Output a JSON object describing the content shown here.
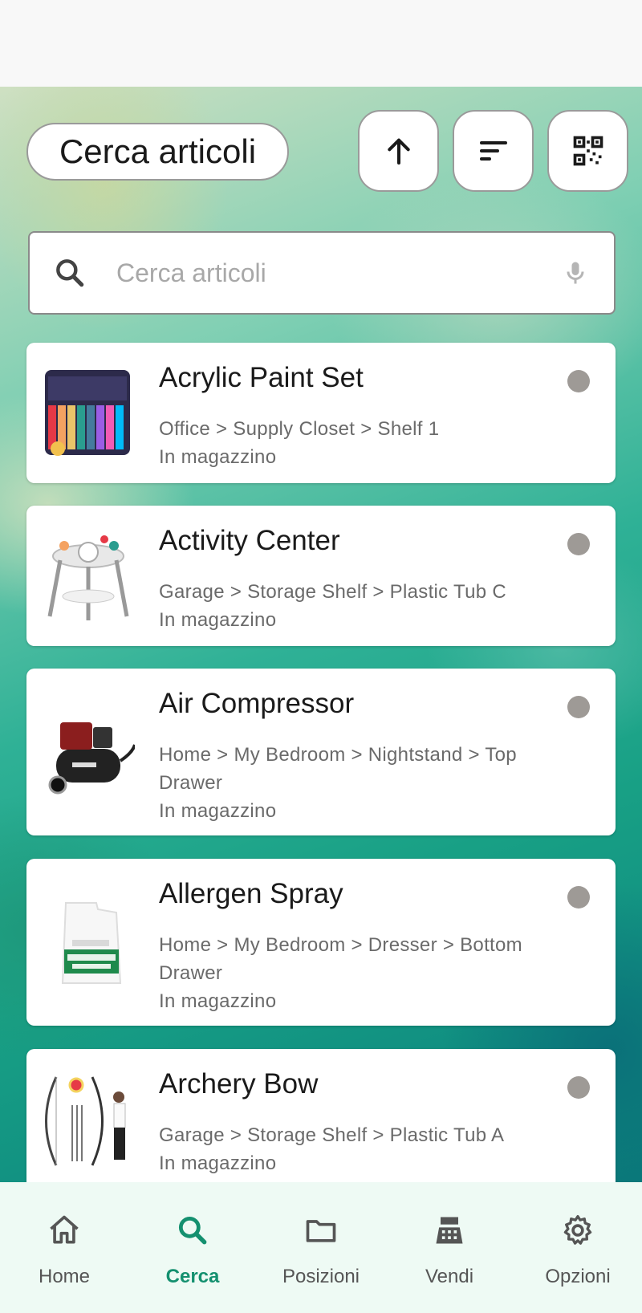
{
  "header": {
    "title": "Cerca articoli",
    "icons": [
      "arrow-up-icon",
      "sort-icon",
      "qr-code-icon"
    ]
  },
  "search": {
    "placeholder": "Cerca articoli"
  },
  "items": [
    {
      "name": "Acrylic Paint Set",
      "path": "Office > Supply Closet > Shelf 1",
      "status": "In magazzino"
    },
    {
      "name": "Activity Center",
      "path": "Garage > Storage Shelf > Plastic Tub C",
      "status": "In magazzino"
    },
    {
      "name": "Air Compressor",
      "path": "Home > My Bedroom > Nightstand > Top Drawer",
      "status": "In magazzino"
    },
    {
      "name": "Allergen Spray",
      "path": "Home > My Bedroom > Dresser > Bottom Drawer",
      "status": "In magazzino"
    },
    {
      "name": "Archery Bow",
      "path": "Garage > Storage Shelf > Plastic Tub A",
      "status": "In magazzino"
    }
  ],
  "nav": {
    "items": [
      {
        "label": "Home",
        "icon": "home-icon"
      },
      {
        "label": "Cerca",
        "icon": "search-icon"
      },
      {
        "label": "Posizioni",
        "icon": "folder-icon"
      },
      {
        "label": "Vendi",
        "icon": "cash-register-icon"
      },
      {
        "label": "Opzioni",
        "icon": "gear-icon"
      }
    ],
    "active": "Cerca"
  },
  "colors": {
    "accent": "#14906f",
    "status_dot": "#9e9a96",
    "nav_background": "#eefaf4"
  }
}
